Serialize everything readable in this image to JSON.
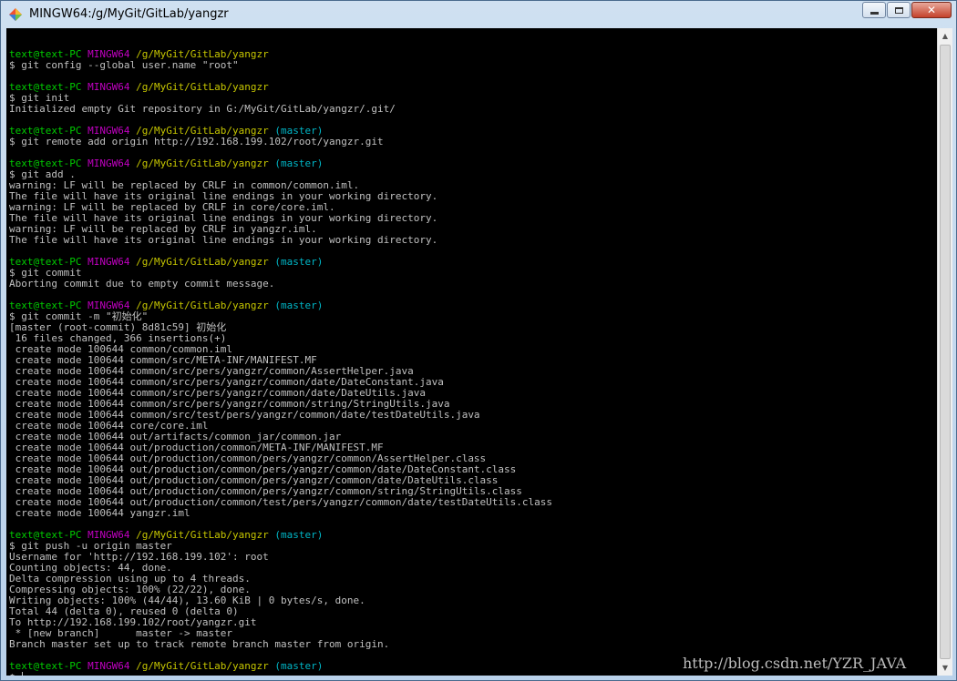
{
  "window": {
    "title": "MINGW64:/g/MyGit/GitLab/yangzr",
    "buttons": {
      "close_label": "✕"
    }
  },
  "terminal": {
    "lines": [
      [],
      [
        {
          "t": "text@text-PC",
          "c": "user"
        },
        {
          "t": " "
        },
        {
          "t": "MINGW64",
          "c": "sys"
        },
        {
          "t": " "
        },
        {
          "t": "/g/MyGit/GitLab/yangzr",
          "c": "path"
        }
      ],
      [
        {
          "t": "$ git config --global user.name \"root\""
        }
      ],
      [],
      [
        {
          "t": "text@text-PC",
          "c": "user"
        },
        {
          "t": " "
        },
        {
          "t": "MINGW64",
          "c": "sys"
        },
        {
          "t": " "
        },
        {
          "t": "/g/MyGit/GitLab/yangzr",
          "c": "path"
        }
      ],
      [
        {
          "t": "$ git init"
        }
      ],
      [
        {
          "t": "Initialized empty Git repository in G:/MyGit/GitLab/yangzr/.git/"
        }
      ],
      [],
      [
        {
          "t": "text@text-PC",
          "c": "user"
        },
        {
          "t": " "
        },
        {
          "t": "MINGW64",
          "c": "sys"
        },
        {
          "t": " "
        },
        {
          "t": "/g/MyGit/GitLab/yangzr",
          "c": "path"
        },
        {
          "t": " "
        },
        {
          "t": "(master)",
          "c": "branch"
        }
      ],
      [
        {
          "t": "$ git remote add origin http://192.168.199.102/root/yangzr.git"
        }
      ],
      [],
      [
        {
          "t": "text@text-PC",
          "c": "user"
        },
        {
          "t": " "
        },
        {
          "t": "MINGW64",
          "c": "sys"
        },
        {
          "t": " "
        },
        {
          "t": "/g/MyGit/GitLab/yangzr",
          "c": "path"
        },
        {
          "t": " "
        },
        {
          "t": "(master)",
          "c": "branch"
        }
      ],
      [
        {
          "t": "$ git add ."
        }
      ],
      [
        {
          "t": "warning: LF will be replaced by CRLF in common/common.iml."
        }
      ],
      [
        {
          "t": "The file will have its original line endings in your working directory."
        }
      ],
      [
        {
          "t": "warning: LF will be replaced by CRLF in core/core.iml."
        }
      ],
      [
        {
          "t": "The file will have its original line endings in your working directory."
        }
      ],
      [
        {
          "t": "warning: LF will be replaced by CRLF in yangzr.iml."
        }
      ],
      [
        {
          "t": "The file will have its original line endings in your working directory."
        }
      ],
      [],
      [
        {
          "t": "text@text-PC",
          "c": "user"
        },
        {
          "t": " "
        },
        {
          "t": "MINGW64",
          "c": "sys"
        },
        {
          "t": " "
        },
        {
          "t": "/g/MyGit/GitLab/yangzr",
          "c": "path"
        },
        {
          "t": " "
        },
        {
          "t": "(master)",
          "c": "branch"
        }
      ],
      [
        {
          "t": "$ git commit"
        }
      ],
      [
        {
          "t": "Aborting commit due to empty commit message."
        }
      ],
      [],
      [
        {
          "t": "text@text-PC",
          "c": "user"
        },
        {
          "t": " "
        },
        {
          "t": "MINGW64",
          "c": "sys"
        },
        {
          "t": " "
        },
        {
          "t": "/g/MyGit/GitLab/yangzr",
          "c": "path"
        },
        {
          "t": " "
        },
        {
          "t": "(master)",
          "c": "branch"
        }
      ],
      [
        {
          "t": "$ git commit -m \"初始化\""
        }
      ],
      [
        {
          "t": "[master (root-commit) 8d81c59] 初始化"
        }
      ],
      [
        {
          "t": " 16 files changed, 366 insertions(+)"
        }
      ],
      [
        {
          "t": " create mode 100644 common/common.iml"
        }
      ],
      [
        {
          "t": " create mode 100644 common/src/META-INF/MANIFEST.MF"
        }
      ],
      [
        {
          "t": " create mode 100644 common/src/pers/yangzr/common/AssertHelper.java"
        }
      ],
      [
        {
          "t": " create mode 100644 common/src/pers/yangzr/common/date/DateConstant.java"
        }
      ],
      [
        {
          "t": " create mode 100644 common/src/pers/yangzr/common/date/DateUtils.java"
        }
      ],
      [
        {
          "t": " create mode 100644 common/src/pers/yangzr/common/string/StringUtils.java"
        }
      ],
      [
        {
          "t": " create mode 100644 common/src/test/pers/yangzr/common/date/testDateUtils.java"
        }
      ],
      [
        {
          "t": " create mode 100644 core/core.iml"
        }
      ],
      [
        {
          "t": " create mode 100644 out/artifacts/common_jar/common.jar"
        }
      ],
      [
        {
          "t": " create mode 100644 out/production/common/META-INF/MANIFEST.MF"
        }
      ],
      [
        {
          "t": " create mode 100644 out/production/common/pers/yangzr/common/AssertHelper.class"
        }
      ],
      [
        {
          "t": " create mode 100644 out/production/common/pers/yangzr/common/date/DateConstant.class"
        }
      ],
      [
        {
          "t": " create mode 100644 out/production/common/pers/yangzr/common/date/DateUtils.class"
        }
      ],
      [
        {
          "t": " create mode 100644 out/production/common/pers/yangzr/common/string/StringUtils.class"
        }
      ],
      [
        {
          "t": " create mode 100644 out/production/common/test/pers/yangzr/common/date/testDateUtils.class"
        }
      ],
      [
        {
          "t": " create mode 100644 yangzr.iml"
        }
      ],
      [],
      [
        {
          "t": "text@text-PC",
          "c": "user"
        },
        {
          "t": " "
        },
        {
          "t": "MINGW64",
          "c": "sys"
        },
        {
          "t": " "
        },
        {
          "t": "/g/MyGit/GitLab/yangzr",
          "c": "path"
        },
        {
          "t": " "
        },
        {
          "t": "(master)",
          "c": "branch"
        }
      ],
      [
        {
          "t": "$ git push -u origin master"
        }
      ],
      [
        {
          "t": "Username for 'http://192.168.199.102': root"
        }
      ],
      [
        {
          "t": "Counting objects: 44, done."
        }
      ],
      [
        {
          "t": "Delta compression using up to 4 threads."
        }
      ],
      [
        {
          "t": "Compressing objects: 100% (22/22), done."
        }
      ],
      [
        {
          "t": "Writing objects: 100% (44/44), 13.60 KiB | 0 bytes/s, done."
        }
      ],
      [
        {
          "t": "Total 44 (delta 0), reused 0 (delta 0)"
        }
      ],
      [
        {
          "t": "To http://192.168.199.102/root/yangzr.git"
        }
      ],
      [
        {
          "t": " * [new branch]      master -> master"
        }
      ],
      [
        {
          "t": "Branch master set up to track remote branch master from origin."
        }
      ],
      [],
      [
        {
          "t": "text@text-PC",
          "c": "user"
        },
        {
          "t": " "
        },
        {
          "t": "MINGW64",
          "c": "sys"
        },
        {
          "t": " "
        },
        {
          "t": "/g/MyGit/GitLab/yangzr",
          "c": "path"
        },
        {
          "t": " "
        },
        {
          "t": "(master)",
          "c": "branch"
        }
      ],
      [
        {
          "t": "$ "
        }
      ]
    ]
  },
  "watermark": "http://blog.csdn.net/YZR_JAVA",
  "colors": {
    "user": "#00cc00",
    "system": "#c000c0",
    "path": "#c6c600",
    "branch": "#00b6c6",
    "text": "#c0c0c0",
    "background": "#000000"
  }
}
